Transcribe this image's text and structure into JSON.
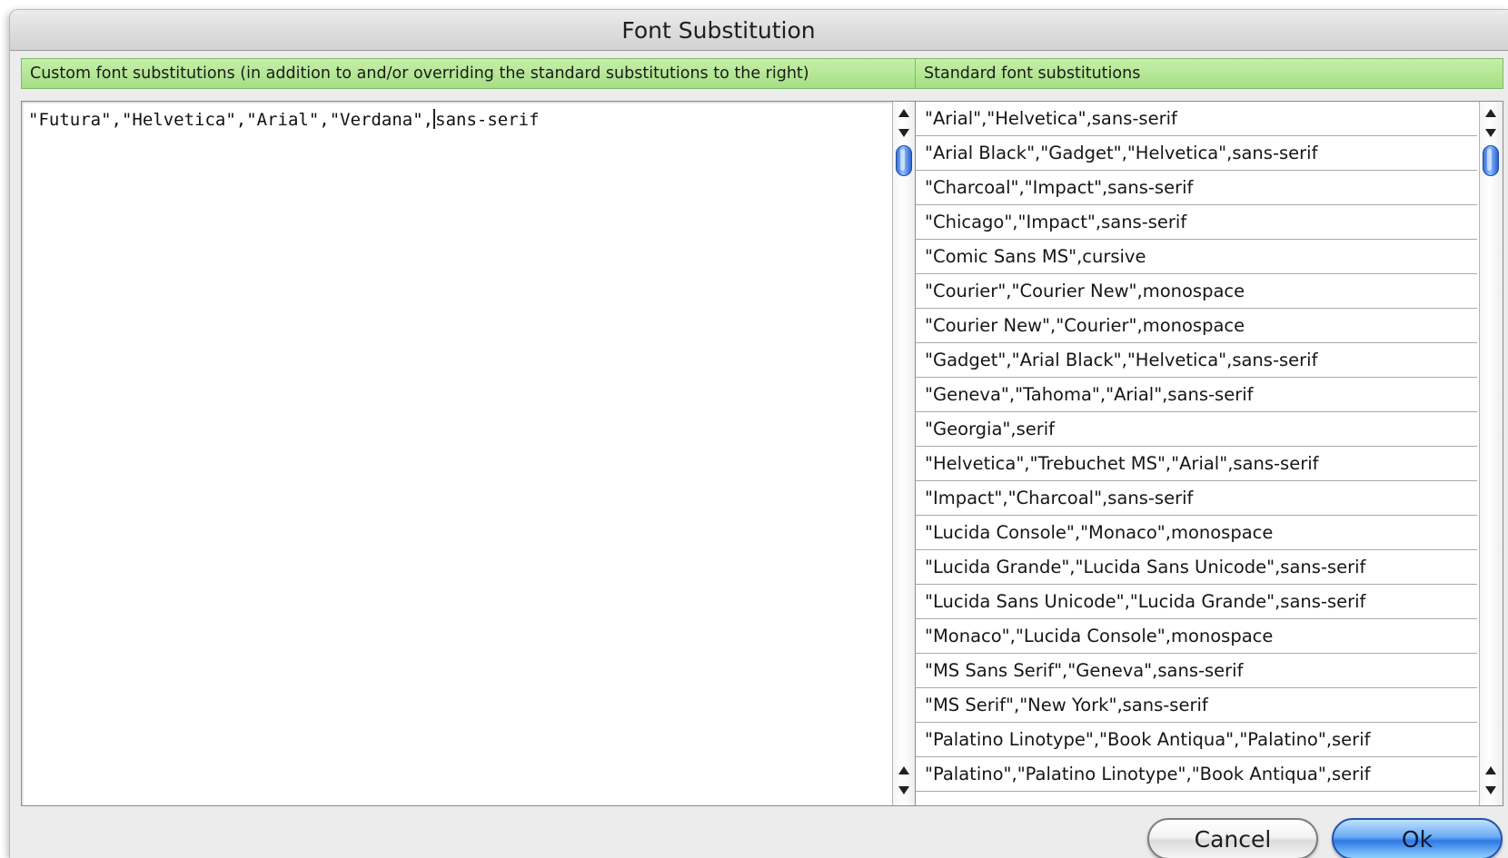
{
  "window": {
    "title": "Font Substitution"
  },
  "custom_panel": {
    "header": "Custom font substitutions (in addition to and/or overriding the standard substitutions to the right)",
    "text_before_cursor": "\"Futura\",\"Helvetica\",\"Arial\",\"Verdana\",",
    "text_after_cursor": "sans-serif"
  },
  "standard_panel": {
    "header": "Standard font substitutions",
    "items": [
      "\"Arial\",\"Helvetica\",sans-serif",
      "\"Arial Black\",\"Gadget\",\"Helvetica\",sans-serif",
      "\"Charcoal\",\"Impact\",sans-serif",
      "\"Chicago\",\"Impact\",sans-serif",
      "\"Comic Sans MS\",cursive",
      "\"Courier\",\"Courier New\",monospace",
      "\"Courier New\",\"Courier\",monospace",
      "\"Gadget\",\"Arial Black\",\"Helvetica\",sans-serif",
      "\"Geneva\",\"Tahoma\",\"Arial\",sans-serif",
      "\"Georgia\",serif",
      "\"Helvetica\",\"Trebuchet MS\",\"Arial\",sans-serif",
      "\"Impact\",\"Charcoal\",sans-serif",
      "\"Lucida Console\",\"Monaco\",monospace",
      "\"Lucida Grande\",\"Lucida Sans Unicode\",sans-serif",
      "\"Lucida Sans Unicode\",\"Lucida Grande\",sans-serif",
      "\"Monaco\",\"Lucida Console\",monospace",
      "\"MS Sans Serif\",\"Geneva\",sans-serif",
      "\"MS Serif\",\"New York\",sans-serif",
      "\"Palatino Linotype\",\"Book Antiqua\",\"Palatino\",serif",
      "\"Palatino\",\"Palatino Linotype\",\"Book Antiqua\",serif"
    ]
  },
  "buttons": {
    "cancel": "Cancel",
    "ok": "Ok"
  },
  "colors": {
    "header_green": "#a5de84",
    "ok_blue": "#2e79e6",
    "scroll_thumb_blue": "#3c73d8"
  },
  "icons": {
    "scroll_up": "arrow-up-icon",
    "scroll_down": "arrow-down-icon"
  }
}
